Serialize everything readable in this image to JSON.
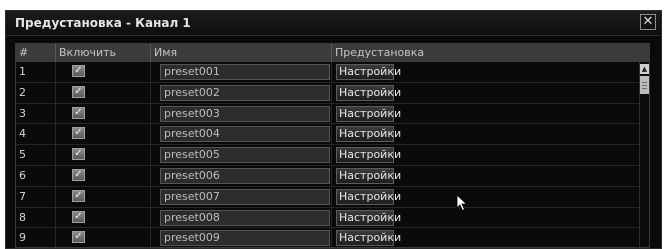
{
  "dialog": {
    "title": "Предустановка - Канал 1",
    "close_symbol": "✕"
  },
  "table": {
    "headers": {
      "num": "#",
      "enable": "Включить",
      "name": "Имя",
      "preset": "Предустановка"
    },
    "rows": [
      {
        "num": "1",
        "checked": true,
        "name": "preset001",
        "button": "Настройки"
      },
      {
        "num": "2",
        "checked": true,
        "name": "preset002",
        "button": "Настройки"
      },
      {
        "num": "3",
        "checked": true,
        "name": "preset003",
        "button": "Настройки"
      },
      {
        "num": "4",
        "checked": true,
        "name": "preset004",
        "button": "Настройки"
      },
      {
        "num": "5",
        "checked": true,
        "name": "preset005",
        "button": "Настройки"
      },
      {
        "num": "6",
        "checked": true,
        "name": "preset006",
        "button": "Настройки"
      },
      {
        "num": "7",
        "checked": true,
        "name": "preset007",
        "button": "Настройки"
      },
      {
        "num": "8",
        "checked": true,
        "name": "preset008",
        "button": "Настройки"
      },
      {
        "num": "9",
        "checked": true,
        "name": "preset009",
        "button": "Настройки"
      }
    ]
  },
  "icons": {
    "checkmark": "✓",
    "scroll_up": "▲"
  }
}
